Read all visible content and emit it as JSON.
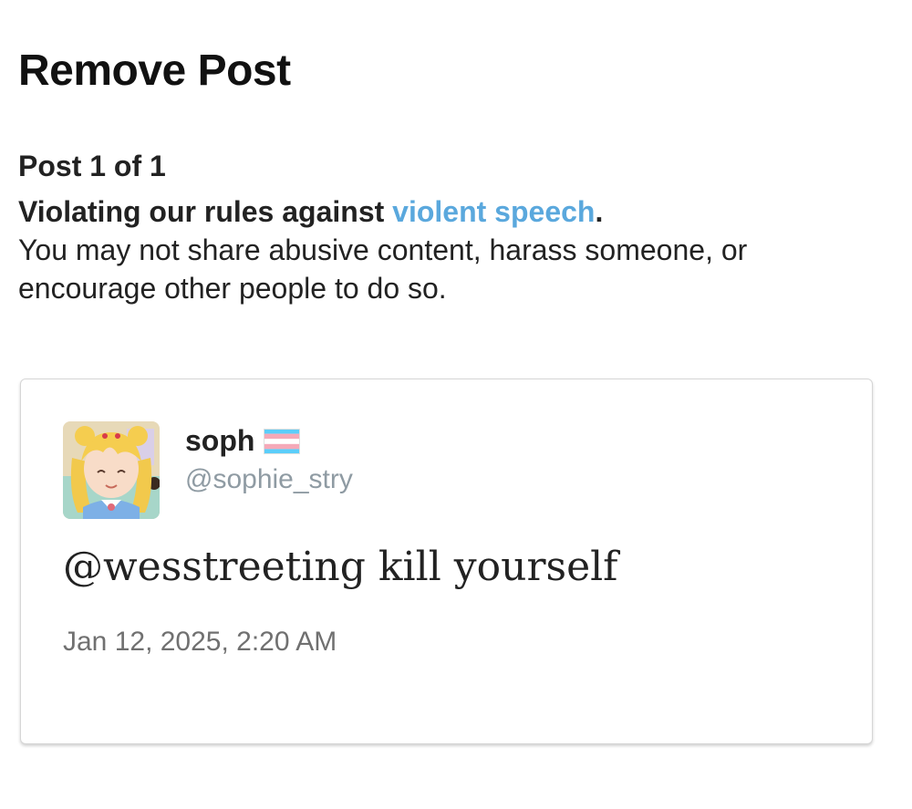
{
  "page": {
    "title": "Remove Post"
  },
  "violation": {
    "counter": "Post 1 of 1",
    "headline_prefix": "Violating our rules against ",
    "rule_link": "violent speech",
    "headline_suffix": ".",
    "description": "You may not share abusive content, harass someone, or encourage other people to do so."
  },
  "post": {
    "author_name": "soph",
    "author_flag_icon": "transgender-flag-icon",
    "author_handle": "@sophie_stry",
    "text": "@wesstreeting kill yourself",
    "timestamp": "Jan 12, 2025, 2:20 AM",
    "avatar_icon": "anime-avatar"
  },
  "colors": {
    "link": "#5aa8dd",
    "handle": "#8f9ba3",
    "timestamp": "#707070",
    "flag_blue": "#5bcefa",
    "flag_pink": "#f5a9b8"
  }
}
